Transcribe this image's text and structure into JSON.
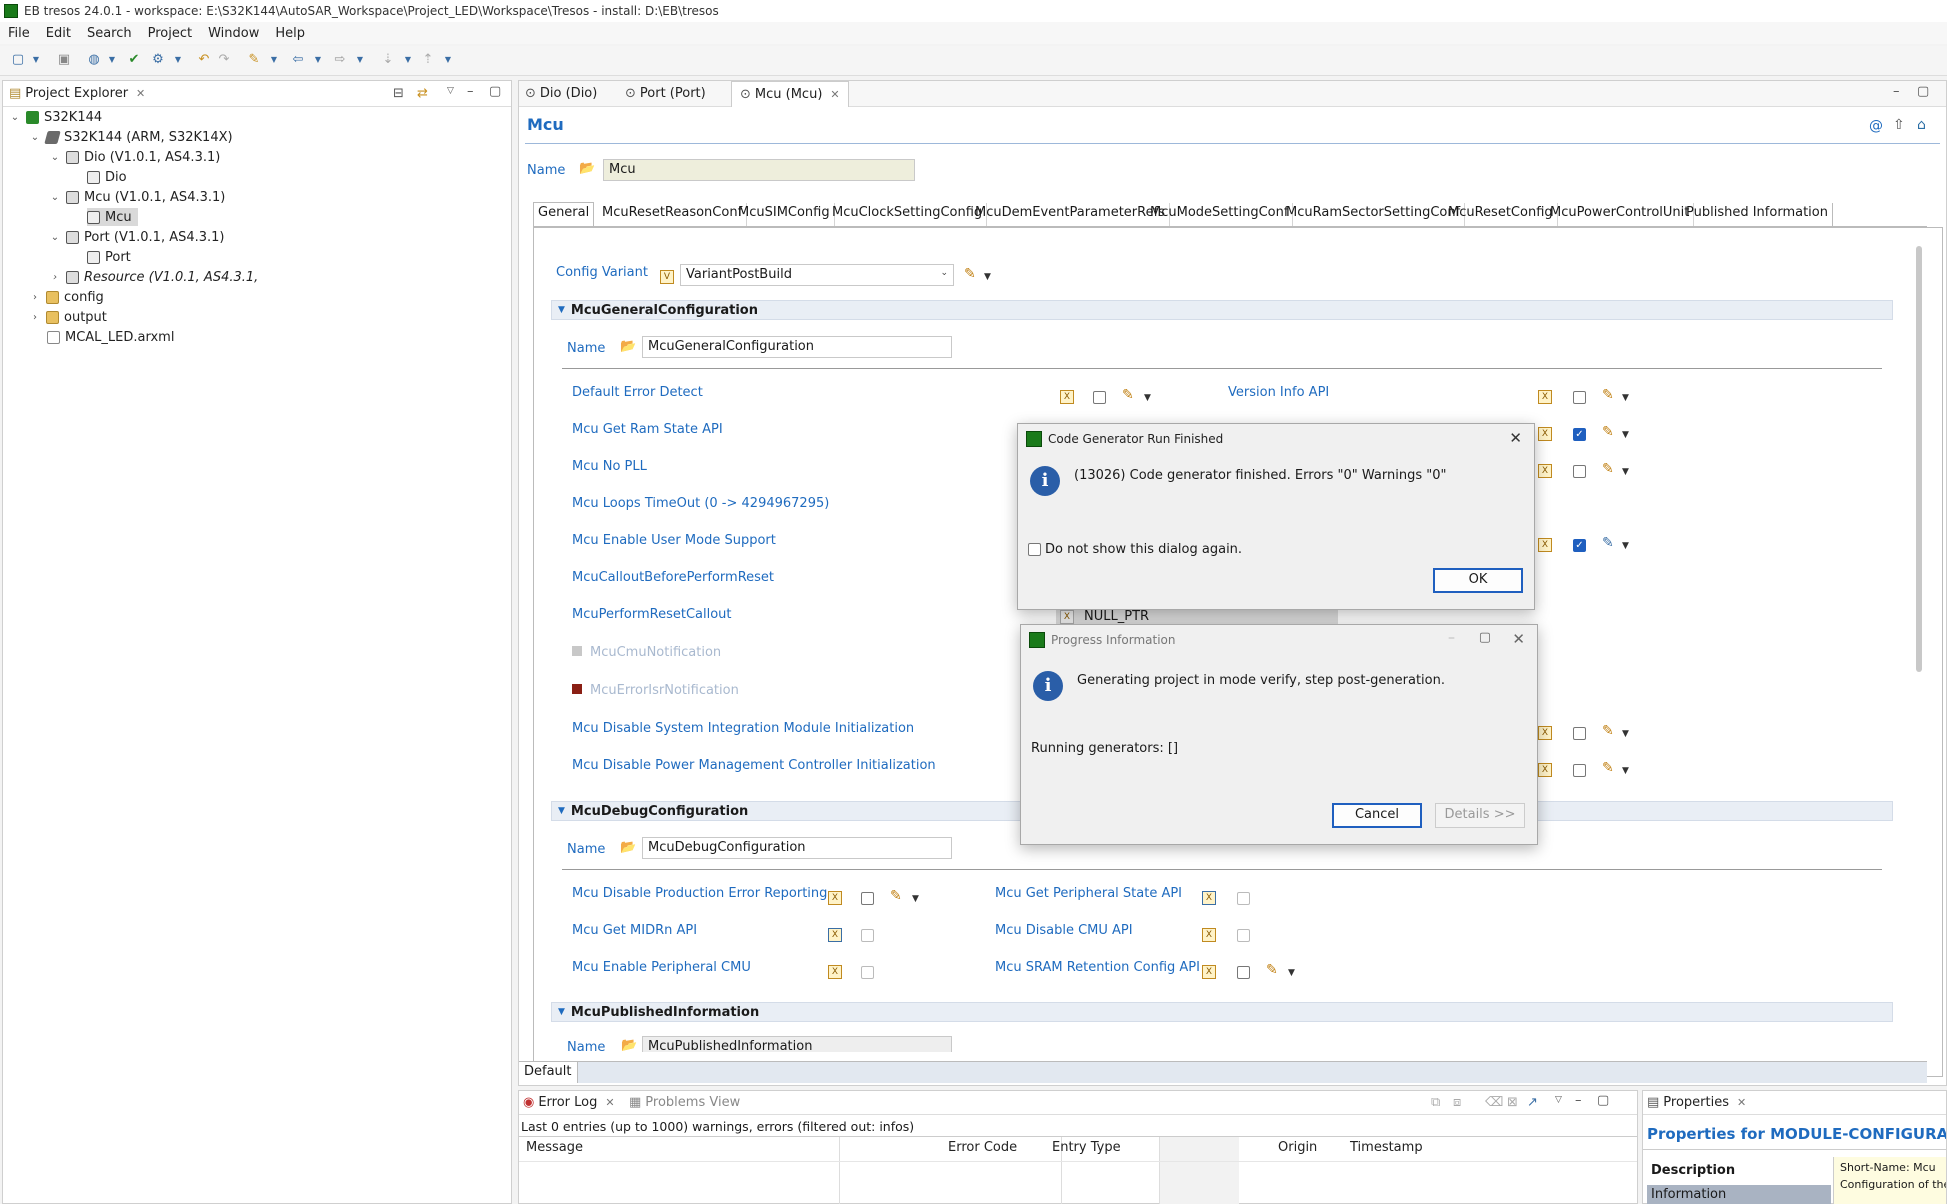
{
  "window": {
    "title": "EB tresos 24.0.1 - workspace: E:\\S32K144\\AutoSAR_Workspace\\Project_LED\\Workspace\\Tresos - install: D:\\EB\\tresos"
  },
  "menu": [
    "File",
    "Edit",
    "Search",
    "Project",
    "Window",
    "Help"
  ],
  "project_explorer": {
    "title": "Project Explorer",
    "tree": [
      {
        "label": "S32K144",
        "level": 0,
        "twisty": "v"
      },
      {
        "label": "S32K144 (ARM, S32K14X)",
        "level": 1,
        "twisty": "v"
      },
      {
        "label": "Dio (V1.0.1, AS4.3.1)",
        "level": 2,
        "twisty": "v"
      },
      {
        "label": "Dio",
        "level": 3,
        "twisty": ""
      },
      {
        "label": "Mcu (V1.0.1, AS4.3.1)",
        "level": 2,
        "twisty": "v"
      },
      {
        "label": "Mcu",
        "level": 3,
        "twisty": "",
        "selected": true
      },
      {
        "label": "Port (V1.0.1, AS4.3.1)",
        "level": 2,
        "twisty": "v"
      },
      {
        "label": "Port",
        "level": 3,
        "twisty": ""
      },
      {
        "label": "Resource (V1.0.1, AS4.3.1,",
        "level": 2,
        "twisty": ">",
        "italic": true
      },
      {
        "label": "config",
        "level": 1,
        "twisty": ">"
      },
      {
        "label": "output",
        "level": 1,
        "twisty": ">"
      },
      {
        "label": "MCAL_LED.arxml",
        "level": 1,
        "twisty": ""
      }
    ]
  },
  "editor": {
    "tabs": [
      "Dio (Dio)",
      "Port (Port)",
      "Mcu (Mcu)"
    ],
    "heading": "Mcu",
    "name_label": "Name",
    "name_value": "Mcu",
    "sub_tabs": [
      "General",
      "McuResetReasonConf",
      "McuSIMConfig",
      "McuClockSettingConfig",
      "McuDemEventParameterRefs",
      "McuModeSettingConf",
      "McuRamSectorSettingConf",
      "McuResetConfig",
      "McuPowerControlUnit",
      "Published Information"
    ],
    "config_variant_label": "Config Variant",
    "config_variant_value": "VariantPostBuild",
    "general_section": "McuGeneralConfiguration",
    "general_name_label": "Name",
    "general_name_value": "McuGeneralConfiguration",
    "general_params": [
      "Default Error Detect",
      "Mcu Get Ram State API",
      "Mcu No PLL",
      "Mcu Loops TimeOut (0 -> 4294967295)",
      "Mcu Enable User Mode Support",
      "McuCalloutBeforePerformReset",
      "McuPerformResetCallout",
      "McuCmuNotification",
      "McuErrorIsrNotification",
      "Mcu Disable System Integration Module Initialization",
      "Mcu Disable Power Management Controller Initialization"
    ],
    "version_info_label": "Version Info API",
    "null_ptr": "NULL_PTR",
    "debug_section": "McuDebugConfiguration",
    "debug_name_label": "Name",
    "debug_name_value": "McuDebugConfiguration",
    "debug_left": [
      "Mcu Disable Production Error Reporting",
      "Mcu Get MIDRn API",
      "Mcu Enable Peripheral CMU"
    ],
    "debug_right": [
      "Mcu Get Peripheral State API",
      "Mcu Disable CMU API",
      "Mcu SRAM Retention Config API"
    ],
    "published_section": "McuPublishedInformation",
    "published_name_label": "Name",
    "published_name_value": "McuPublishedInformation",
    "bottom_tab": "Default"
  },
  "dialog_finished": {
    "title": "Code Generator Run Finished",
    "message": "(13026) Code generator finished. Errors \"0\" Warnings \"0\"",
    "checkbox": "Do not show this dialog again.",
    "ok": "OK"
  },
  "dialog_progress": {
    "title": "Progress Information",
    "message": "Generating project in mode verify, step post-generation.",
    "running": "Running generators: []",
    "cancel": "Cancel",
    "details": "Details >>"
  },
  "error_log": {
    "tab1": "Error Log",
    "tab2": "Problems View",
    "summary": "Last 0 entries (up to 1000) warnings, errors (filtered out: infos)",
    "columns": [
      "Message",
      "Error Code",
      "Entry Type",
      "Origin",
      "Timestamp"
    ]
  },
  "properties": {
    "tab": "Properties",
    "title": "Properties for MODULE-CONFIGURATIO",
    "rows": [
      "Description",
      "Information"
    ],
    "short_name": "Short-Name: Mcu",
    "config_text": "Configuration of the"
  }
}
